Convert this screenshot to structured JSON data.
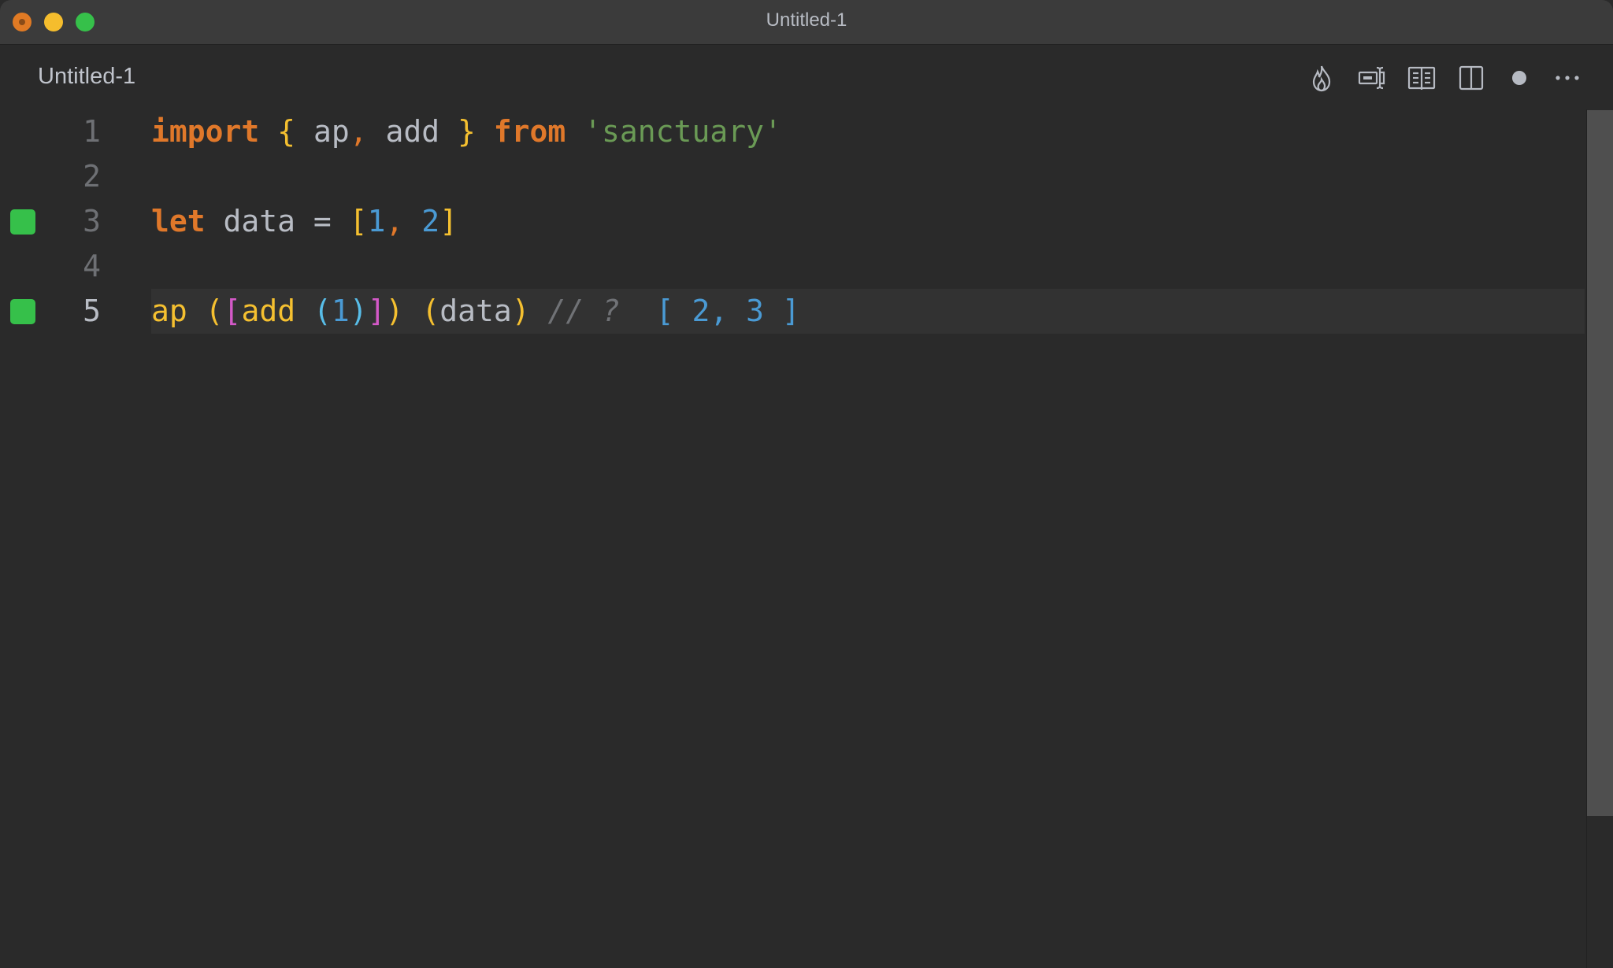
{
  "window": {
    "title": "Untitled-1",
    "traffic_lights": [
      "close",
      "minimize",
      "maximize"
    ]
  },
  "tab": {
    "label": "Untitled-1"
  },
  "toolbar": {
    "icons": [
      {
        "name": "flame-icon",
        "label": "Quokka"
      },
      {
        "name": "rename-cursor-icon",
        "label": "Text cursor"
      },
      {
        "name": "open-preview-book-icon",
        "label": "Open Preview"
      },
      {
        "name": "split-editor-icon",
        "label": "Split Editor"
      },
      {
        "name": "unsaved-dot-icon",
        "label": "Unsaved"
      },
      {
        "name": "more-actions-icon",
        "label": "More Actions"
      }
    ]
  },
  "editor": {
    "current_line": 5,
    "lines": [
      {
        "number": "1",
        "marker": false,
        "tokens": [
          {
            "t": "import",
            "c": "kw"
          },
          {
            "t": " ",
            "c": "ident"
          },
          {
            "t": "{",
            "c": "brace"
          },
          {
            "t": " ap",
            "c": "ident"
          },
          {
            "t": ",",
            "c": "punct"
          },
          {
            "t": " add ",
            "c": "ident"
          },
          {
            "t": "}",
            "c": "brace"
          },
          {
            "t": " ",
            "c": "ident"
          },
          {
            "t": "from",
            "c": "kw"
          },
          {
            "t": " ",
            "c": "ident"
          },
          {
            "t": "'sanctuary'",
            "c": "str"
          }
        ]
      },
      {
        "number": "2",
        "marker": false,
        "tokens": []
      },
      {
        "number": "3",
        "marker": true,
        "tokens": [
          {
            "t": "let",
            "c": "kw"
          },
          {
            "t": " data = ",
            "c": "ident"
          },
          {
            "t": "[",
            "c": "brace"
          },
          {
            "t": "1",
            "c": "num"
          },
          {
            "t": ",",
            "c": "punct"
          },
          {
            "t": " ",
            "c": "ident"
          },
          {
            "t": "2",
            "c": "num"
          },
          {
            "t": "]",
            "c": "brace"
          }
        ]
      },
      {
        "number": "4",
        "marker": false,
        "tokens": []
      },
      {
        "number": "5",
        "marker": true,
        "tokens": [
          {
            "t": "ap",
            "c": "fn"
          },
          {
            "t": " ",
            "c": "ident"
          },
          {
            "t": "(",
            "c": "paren-y"
          },
          {
            "t": "[",
            "c": "paren-m"
          },
          {
            "t": "add",
            "c": "fn"
          },
          {
            "t": " ",
            "c": "ident"
          },
          {
            "t": "(",
            "c": "paren-b"
          },
          {
            "t": "1",
            "c": "num"
          },
          {
            "t": ")",
            "c": "paren-b"
          },
          {
            "t": "]",
            "c": "paren-m"
          },
          {
            "t": ")",
            "c": "paren-y"
          },
          {
            "t": " ",
            "c": "ident"
          },
          {
            "t": "(",
            "c": "paren-y"
          },
          {
            "t": "data",
            "c": "ident"
          },
          {
            "t": ")",
            "c": "paren-y"
          },
          {
            "t": " // ?  ",
            "c": "comment"
          },
          {
            "t": "[ 2, 3 ]",
            "c": "result"
          }
        ]
      }
    ]
  },
  "colors": {
    "background": "#2a2a2a",
    "titlebar": "#3b3b3b",
    "keyword": "#e0782a",
    "string": "#6a9a55",
    "number": "#4a9ad4",
    "bracket_yellow": "#f5c030",
    "bracket_magenta": "#d459c8",
    "bracket_blue": "#58bde8",
    "coverage_marker": "#36c04a"
  }
}
